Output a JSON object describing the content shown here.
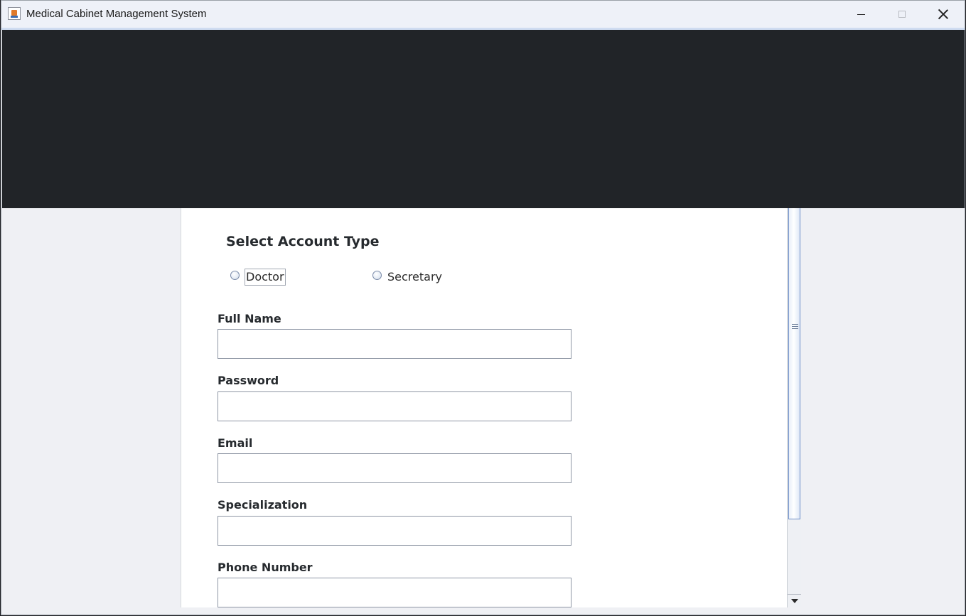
{
  "window": {
    "title": "Medical Cabinet Management System",
    "icon": "java-app-icon",
    "controls": {
      "minimize": "minimize-icon",
      "maximize": "maximize-icon",
      "close": "close-icon"
    }
  },
  "colors": {
    "header_bg": "#212428",
    "form_bg": "#ffffff",
    "window_bg": "#eff0f4",
    "scroll_thumb_border": "#6f8fc9"
  },
  "form": {
    "section_title": "Select Account Type",
    "account_types": [
      {
        "label": "Doctor",
        "selected": false,
        "focused": true
      },
      {
        "label": "Secretary",
        "selected": false,
        "focused": false
      }
    ],
    "fields": [
      {
        "label": "Full Name",
        "value": ""
      },
      {
        "label": "Password",
        "value": ""
      },
      {
        "label": "Email",
        "value": ""
      },
      {
        "label": "Specialization",
        "value": ""
      },
      {
        "label": "Phone Number",
        "value": ""
      }
    ]
  },
  "scrollbar": {
    "grip_icon": "scroll-grip-icon",
    "down_icon": "arrow-down-icon"
  }
}
